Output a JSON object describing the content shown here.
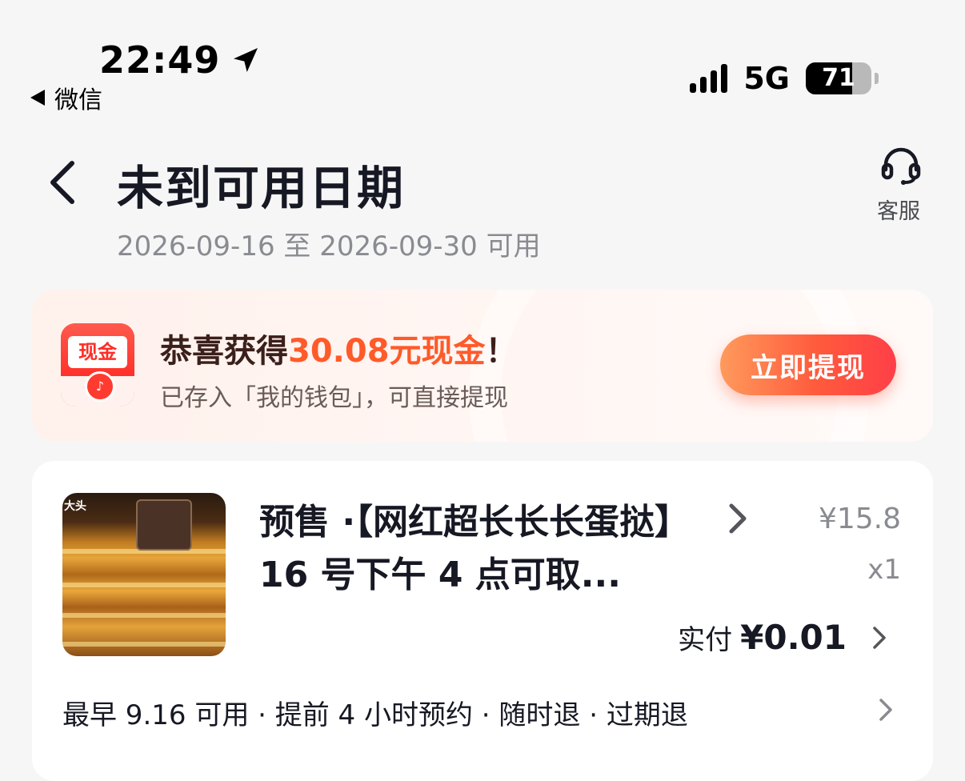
{
  "status_bar": {
    "time": "22:49",
    "back_app": "微信",
    "network": "5G",
    "battery": "71",
    "battery_level": 0.71
  },
  "header": {
    "title": "未到可用日期",
    "date_range": "2026-09-16 至 2026-09-30 可用",
    "service_label": "客服"
  },
  "cash_reward": {
    "icon_text": "现金",
    "title_prefix": "恭喜获得",
    "amount": "30.08元现金",
    "title_suffix": "！",
    "subtitle": "已存入「我的钱包」，可直接提现",
    "button_label": "立即提现"
  },
  "order": {
    "title": "预售 ·【网红超长长长蛋挞】16 号下午 4 点可取...",
    "price": "¥15.8",
    "quantity": "x1",
    "paid_label": "实付",
    "paid_amount": "¥0.01",
    "rules": "最早 9.16 可用 · 提前 4 小时预约 · 随时退 · 过期退"
  },
  "colors": {
    "accent": "#ff5a2a",
    "button_gradient_start": "#ff9a5c",
    "button_gradient_end": "#ff3f48",
    "page_bg": "#f6f6f6"
  },
  "icons": {
    "location": "location-arrow-icon",
    "back": "chevron-left-icon",
    "service": "headset-icon",
    "chevron": "chevron-right-icon"
  }
}
